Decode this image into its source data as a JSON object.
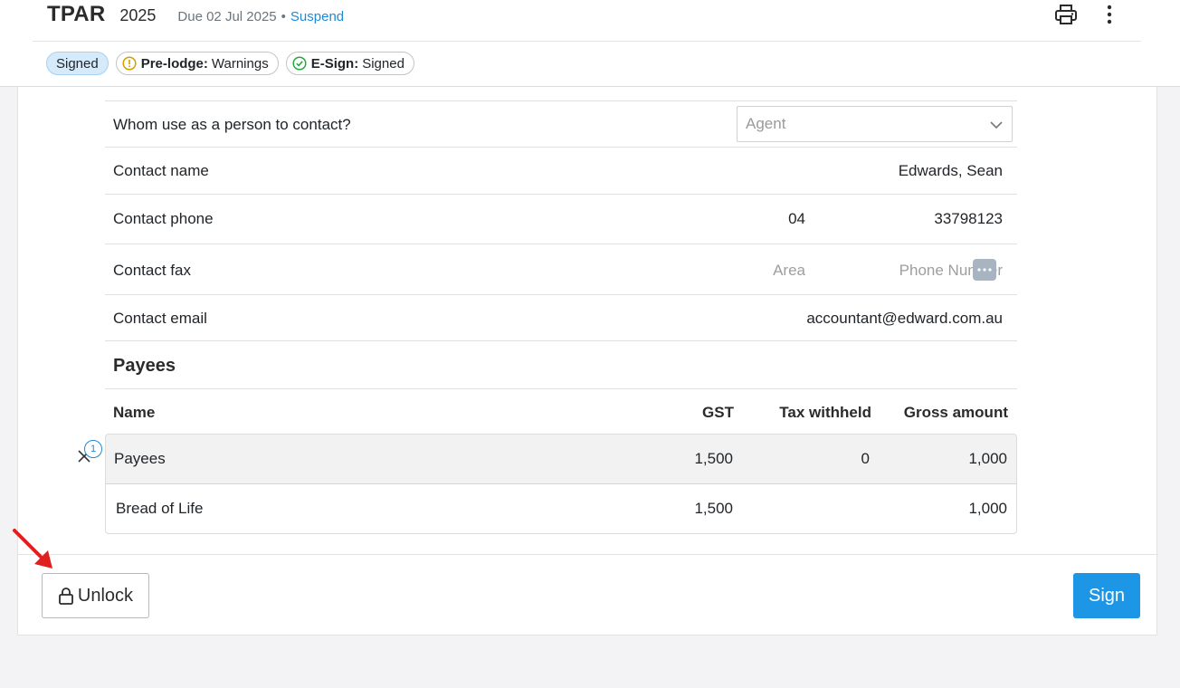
{
  "header": {
    "title": "TPAR",
    "year": "2025",
    "due": "Due 02 Jul 2025",
    "separator": "•",
    "suspend_label": "Suspend",
    "print_icon": "printer-icon",
    "more_icon": "vertical-dots-icon"
  },
  "badges": {
    "signed": "Signed",
    "prelodge_label": "Pre-lodge:",
    "prelodge_value": "Warnings",
    "esign_label": "E-Sign:",
    "esign_value": "Signed"
  },
  "contact": {
    "person_question": "Whom use as a person to contact?",
    "person_value": "Agent",
    "name_label": "Contact name",
    "name_value": "Edwards, Sean",
    "phone_label": "Contact phone",
    "phone_area": "04",
    "phone_number": "33798123",
    "fax_label": "Contact fax",
    "fax_area_placeholder": "Area",
    "fax_number_placeholder": "Phone Number",
    "email_label": "Contact email",
    "email_value": "accountant@edward.com.au"
  },
  "payees": {
    "title": "Payees",
    "columns": [
      "Name",
      "GST",
      "Tax withheld",
      "Gross amount"
    ],
    "group_count": "1",
    "group": {
      "name": "Payees",
      "gst": "1,500",
      "tax": "0",
      "gross": "1,000"
    },
    "rows": [
      {
        "name": "Bread of Life",
        "gst": "1,500",
        "tax": "",
        "gross": "1,000"
      }
    ]
  },
  "footer": {
    "unlock_label": "Unlock",
    "sign_label": "Sign"
  },
  "colors": {
    "accent": "#1d96e6",
    "link": "#1f8ad6",
    "warning": "#d39e00",
    "success": "#28a745",
    "annotation_arrow": "#e02020"
  }
}
